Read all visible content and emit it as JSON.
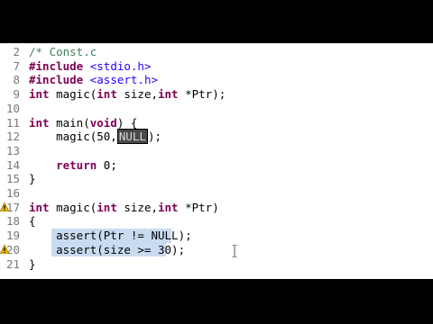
{
  "editor": {
    "lines": [
      {
        "num": "2",
        "tokens": [
          {
            "t": "/* Const.c",
            "c": "cmt"
          }
        ]
      },
      {
        "num": "7",
        "tokens": [
          {
            "t": "#include",
            "c": "dir"
          },
          {
            "t": " ",
            "c": ""
          },
          {
            "t": "<stdio.h>",
            "c": "inc"
          }
        ]
      },
      {
        "num": "8",
        "tokens": [
          {
            "t": "#include",
            "c": "dir"
          },
          {
            "t": " ",
            "c": ""
          },
          {
            "t": "<assert.h>",
            "c": "inc"
          }
        ]
      },
      {
        "num": "9",
        "tokens": [
          {
            "t": "int",
            "c": "kw"
          },
          {
            "t": " magic(",
            "c": ""
          },
          {
            "t": "int",
            "c": "kw"
          },
          {
            "t": " size,",
            "c": ""
          },
          {
            "t": "int",
            "c": "kw"
          },
          {
            "t": " *Ptr);",
            "c": ""
          }
        ]
      },
      {
        "num": "10",
        "tokens": []
      },
      {
        "num": "11",
        "tokens": [
          {
            "t": "int",
            "c": "kw"
          },
          {
            "t": " main(",
            "c": ""
          },
          {
            "t": "void",
            "c": "kw"
          },
          {
            "t": ") {",
            "c": ""
          }
        ]
      },
      {
        "num": "12",
        "tokens": [
          {
            "t": "    magic(50,",
            "c": ""
          },
          {
            "t": "NULL",
            "c": "null"
          },
          {
            "t": ");",
            "c": ""
          }
        ]
      },
      {
        "num": "13",
        "tokens": []
      },
      {
        "num": "14",
        "tokens": [
          {
            "t": "    ",
            "c": ""
          },
          {
            "t": "return",
            "c": "kw"
          },
          {
            "t": " 0;",
            "c": ""
          }
        ]
      },
      {
        "num": "15",
        "tokens": [
          {
            "t": "}",
            "c": ""
          }
        ]
      },
      {
        "num": "16",
        "tokens": []
      },
      {
        "num": "17",
        "tokens": [
          {
            "t": "int",
            "c": "kw"
          },
          {
            "t": " magic(",
            "c": ""
          },
          {
            "t": "int",
            "c": "kw"
          },
          {
            "t": " size,",
            "c": ""
          },
          {
            "t": "int",
            "c": "kw"
          },
          {
            "t": " *Ptr)",
            "c": ""
          }
        ]
      },
      {
        "num": "18",
        "tokens": [
          {
            "t": "{",
            "c": ""
          }
        ]
      },
      {
        "num": "19",
        "tokens": [
          {
            "t": "    assert(Ptr != NULL);",
            "c": ""
          }
        ],
        "selected": true
      },
      {
        "num": "20",
        "tokens": [
          {
            "t": "    assert(size >= 30);",
            "c": ""
          }
        ],
        "selected": true
      },
      {
        "num": "21",
        "tokens": [
          {
            "t": "}",
            "c": ""
          }
        ]
      }
    ]
  },
  "colors": {
    "keyword": "#7f0055",
    "include": "#2a00ff",
    "comment": "#3f7f5f",
    "selection": "#b3cde8",
    "line_number": "#787878"
  },
  "markers": {
    "line_17": "warning-marker-icon",
    "line_20": "warning-marker-icon"
  }
}
